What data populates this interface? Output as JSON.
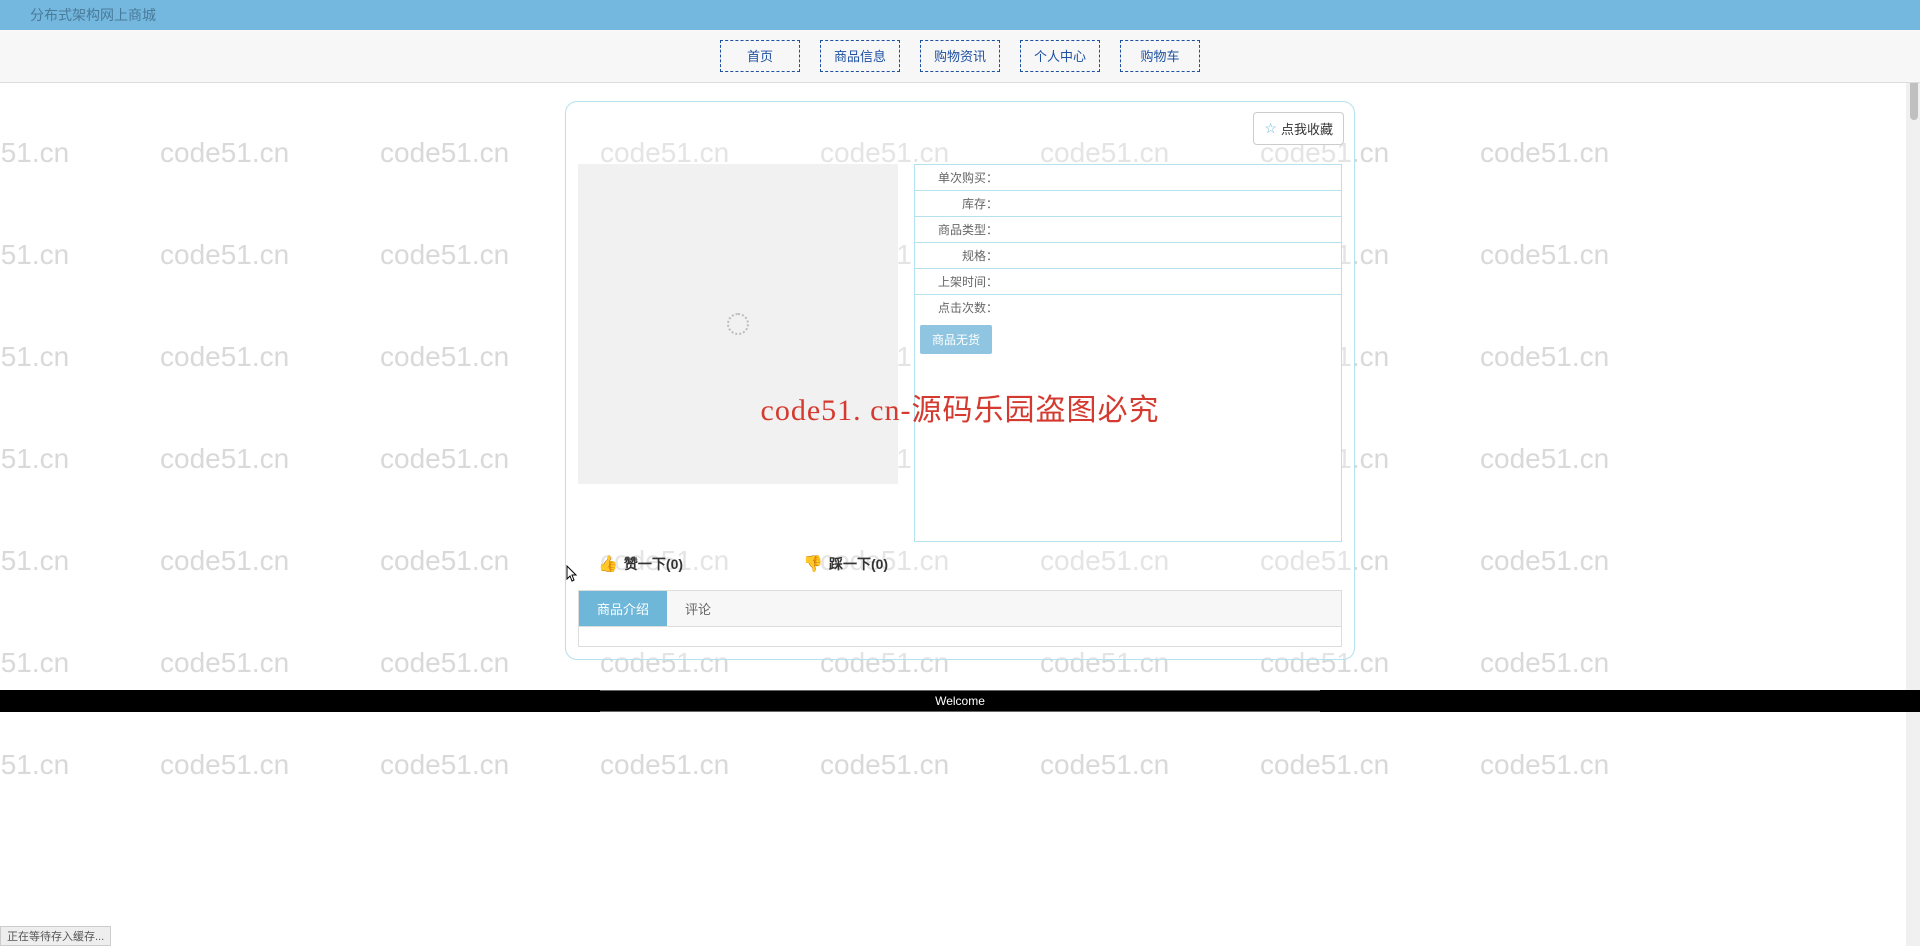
{
  "watermark_text": "code51.cn",
  "center_watermark": "code51. cn-源码乐园盗图必究",
  "header": {
    "title": "分布式架构网上商城"
  },
  "nav": {
    "items": [
      "首页",
      "商品信息",
      "购物资讯",
      "个人中心",
      "购物车"
    ]
  },
  "favorite": {
    "label": "点我收藏"
  },
  "info": {
    "rows": [
      {
        "label": "单次购买："
      },
      {
        "label": "库存："
      },
      {
        "label": "商品类型："
      },
      {
        "label": "规格："
      },
      {
        "label": "上架时间："
      },
      {
        "label": "点击次数："
      }
    ],
    "no_stock": "商品无货"
  },
  "like": {
    "up": "赞一下(0)",
    "down": "踩一下(0)"
  },
  "tabs": {
    "intro": "商品介绍",
    "comment": "评论"
  },
  "footer": {
    "welcome": "Welcome"
  },
  "status": {
    "text": "正在等待存入缓存..."
  }
}
